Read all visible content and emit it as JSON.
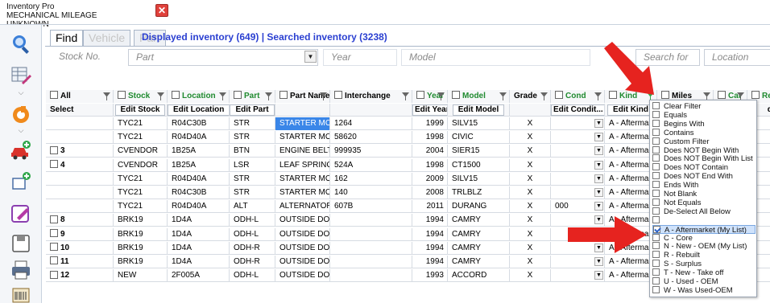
{
  "window": {
    "title_line1": "Inventory Pro",
    "title_line2": "MECHANICAL MILEAGE UNKNOWN",
    "close_glyph": "✕"
  },
  "sidebar": {
    "icons": [
      "search-icon",
      "edit-grid-icon",
      "refresh-icon",
      "add-vehicle-icon",
      "add-part-icon",
      "edit-icon",
      "save-icon",
      "print-icon",
      "barcode-label-icon"
    ]
  },
  "tabs": [
    {
      "label": "Find",
      "active": true
    },
    {
      "label": "Vehicle",
      "active": false
    },
    {
      "label": "Part",
      "active": false
    }
  ],
  "summary": "Displayed inventory (649) | Searched inventory (3238)",
  "search": {
    "stock_placeholder": "Stock No.",
    "part_placeholder": "Part",
    "year_placeholder": "Year",
    "model_placeholder": "Model",
    "searchfor_placeholder": "Search for",
    "location_placeholder": "Location"
  },
  "grid": {
    "headers": [
      "All",
      "Stock",
      "Location",
      "Part",
      "Part Name",
      "Interchange",
      "Year",
      "Model",
      "Grade",
      "Cond",
      "Kind",
      "Miles",
      "Cat",
      "Retail"
    ],
    "edit_row": {
      "select": "Select",
      "stock": "Edit Stock",
      "location": "Edit Location",
      "part": "Edit Part",
      "year": "Edit Year",
      "model": "Edit Model",
      "cond": "Edit Condit...",
      "kind": "Edit Kind",
      "retail": "dit"
    },
    "rows": [
      {
        "sel": "",
        "stock": "TYC21",
        "location": "R04C30B",
        "part": "STR",
        "partname": "STARTER MOT",
        "interchange": "1264",
        "year": "1999",
        "model": "SILV15",
        "grade": "X",
        "cond": "",
        "kind": "A - Aftermar",
        "selected": true
      },
      {
        "sel": "",
        "stock": "TYC21",
        "location": "R04D40A",
        "part": "STR",
        "partname": "STARTER MOT",
        "interchange": "58620",
        "year": "1998",
        "model": "CIVIC",
        "grade": "X",
        "cond": "",
        "kind": "A - Aftermar",
        "selected": false
      },
      {
        "sel": "3",
        "stock": "CVENDOR",
        "location": "1B25A",
        "part": "BTN",
        "partname": "ENGINE BELT T",
        "interchange": "999935",
        "year": "2004",
        "model": "SIER15",
        "grade": "X",
        "cond": "",
        "kind": "A - Aftermar",
        "selected": false
      },
      {
        "sel": "4",
        "stock": "CVENDOR",
        "location": "1B25A",
        "part": "LSR",
        "partname": "LEAF SPRING F",
        "interchange": "524A",
        "year": "1998",
        "model": "CT1500",
        "grade": "X",
        "cond": "",
        "kind": "A - Aftermar",
        "selected": false
      },
      {
        "sel": "",
        "stock": "TYC21",
        "location": "R04D40A",
        "part": "STR",
        "partname": "STARTER MOT",
        "interchange": "162",
        "year": "2009",
        "model": "SILV15",
        "grade": "X",
        "cond": "",
        "kind": "A - Aftermar",
        "selected": false
      },
      {
        "sel": "",
        "stock": "TYC21",
        "location": "R04C30B",
        "part": "STR",
        "partname": "STARTER MOT",
        "interchange": "140",
        "year": "2008",
        "model": "TRLBLZ",
        "grade": "X",
        "cond": "",
        "kind": "A - Aftermar",
        "selected": false
      },
      {
        "sel": "",
        "stock": "TYC21",
        "location": "R04D40A",
        "part": "ALT",
        "partname": "ALTERNATOR",
        "interchange": "607B",
        "year": "2011",
        "model": "DURANG",
        "grade": "X",
        "cond": "000",
        "kind": "A - Aftermar",
        "selected": false
      },
      {
        "sel": "8",
        "stock": "BRK19",
        "location": "1D4A",
        "part": "ODH-L",
        "partname": "OUTSIDE DOOF",
        "interchange": "",
        "year": "1994",
        "model": "CAMRY",
        "grade": "X",
        "cond": "",
        "kind": "A - Aftermar",
        "selected": false
      },
      {
        "sel": "9",
        "stock": "BRK19",
        "location": "1D4A",
        "part": "ODH-L",
        "partname": "OUTSIDE DOOF",
        "interchange": "",
        "year": "1994",
        "model": "CAMRY",
        "grade": "X",
        "cond": "",
        "kind": "A - Aftermar",
        "selected": false
      },
      {
        "sel": "10",
        "stock": "BRK19",
        "location": "1D4A",
        "part": "ODH-R",
        "partname": "OUTSIDE DOOF",
        "interchange": "",
        "year": "1994",
        "model": "CAMRY",
        "grade": "X",
        "cond": "",
        "kind": "A - Aftermar",
        "selected": false
      },
      {
        "sel": "11",
        "stock": "BRK19",
        "location": "1D4A",
        "part": "ODH-R",
        "partname": "OUTSIDE DOOF",
        "interchange": "",
        "year": "1994",
        "model": "CAMRY",
        "grade": "X",
        "cond": "",
        "kind": "A - Aftermar",
        "selected": false
      },
      {
        "sel": "12",
        "stock": "NEW",
        "location": "2F005A",
        "part": "ODH-L",
        "partname": "OUTSIDE DOOF",
        "interchange": "",
        "year": "1993",
        "model": "ACCORD",
        "grade": "X",
        "cond": "",
        "kind": "A - Aftermar",
        "selected": false
      }
    ]
  },
  "filter_menu": {
    "items": [
      {
        "label": "Clear Filter",
        "checked": false
      },
      {
        "label": "Equals",
        "checked": false
      },
      {
        "label": "Begins With",
        "checked": false
      },
      {
        "label": "Contains",
        "checked": false
      },
      {
        "label": "Custom Filter",
        "checked": false
      },
      {
        "label": "Does NOT Begin With",
        "checked": false
      },
      {
        "label": "Does NOT Begin With List",
        "checked": false
      },
      {
        "label": "Does NOT Contain",
        "checked": false
      },
      {
        "label": "Does NOT End With",
        "checked": false
      },
      {
        "label": "Ends With",
        "checked": false
      },
      {
        "label": "Not Blank",
        "checked": false
      },
      {
        "label": "Not Equals",
        "checked": false
      },
      {
        "label": "De-Select All Below",
        "checked": false
      },
      {
        "label": "",
        "checked": false
      },
      {
        "label": "A - Aftermarket (My List)",
        "checked": true
      },
      {
        "label": "C - Core",
        "checked": false
      },
      {
        "label": "N - New - OEM (My List)",
        "checked": false
      },
      {
        "label": "R - Rebuilt",
        "checked": false
      },
      {
        "label": "S - Surplus",
        "checked": false
      },
      {
        "label": "T - New - Take off",
        "checked": false
      },
      {
        "label": "U - Used - OEM",
        "checked": false
      },
      {
        "label": "W - Was Used-OEM",
        "checked": false
      }
    ]
  },
  "colors": {
    "accent_blue": "#2a3fd1",
    "header_green": "#1f8a2f",
    "selection_blue": "#3a86e8",
    "arrow_red": "#e6231f"
  }
}
